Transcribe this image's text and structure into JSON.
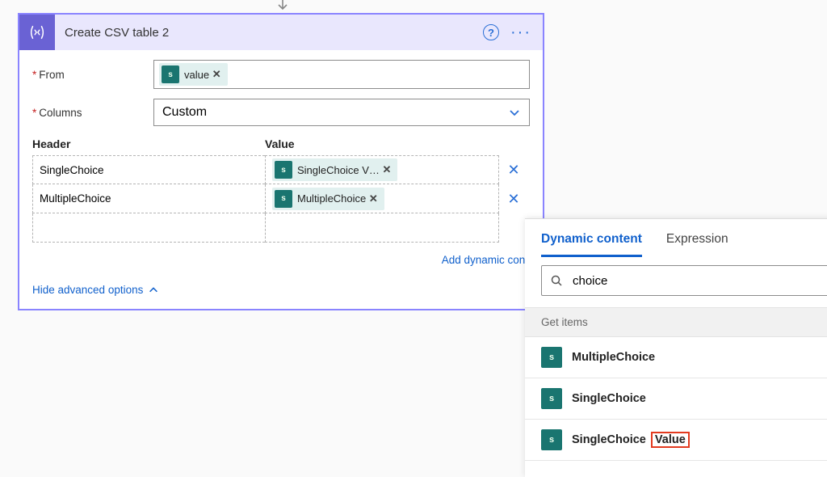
{
  "card": {
    "title": "Create CSV table 2",
    "from_label": "From",
    "from_token": "value",
    "columns_label": "Columns",
    "columns_value": "Custom",
    "header_header": "Header",
    "value_header": "Value",
    "rows": [
      {
        "header": "SingleChoice",
        "value_token": "SingleChoice V…"
      },
      {
        "header": "MultipleChoice",
        "value_token": "MultipleChoice"
      },
      {
        "header": "",
        "value_token": ""
      }
    ],
    "add_dynamic": "Add dynamic cont",
    "hide_advanced": "Hide advanced options"
  },
  "dc": {
    "tab_dynamic": "Dynamic content",
    "tab_expression": "Expression",
    "search_value": "choice",
    "section": "Get items",
    "items": [
      {
        "label": "MultipleChoice",
        "highlight_suffix": ""
      },
      {
        "label": "SingleChoice",
        "highlight_suffix": ""
      },
      {
        "label": "SingleChoice",
        "highlight_suffix": "Value"
      }
    ]
  },
  "icons": {
    "sp_glyph": "s"
  }
}
